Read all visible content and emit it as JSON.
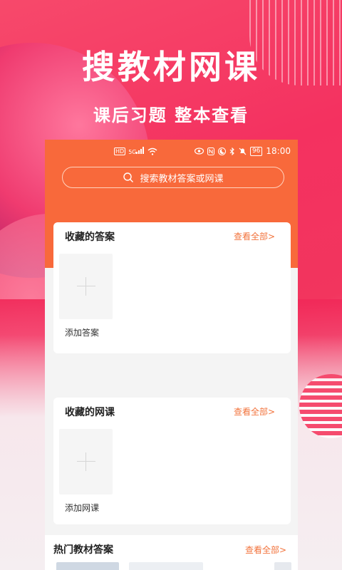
{
  "promo": {
    "headline": "搜教材网课",
    "subline": "课后习题 整本查看"
  },
  "statusbar": {
    "left_icons": [
      "hd-icon",
      "5g-signal-icon",
      "wifi-icon"
    ],
    "left_hd": "HD",
    "left_5g": "5G",
    "right_icons": [
      "eye-icon",
      "nfc-icon",
      "moon-icon",
      "bluetooth-icon",
      "mute-bell-icon"
    ],
    "battery": "96",
    "time": "18:00"
  },
  "search": {
    "placeholder": "搜索教材答案或网课"
  },
  "answers_card": {
    "title": "收藏的答案",
    "more": "查看全部>",
    "add_label": "添加答案"
  },
  "courses_card": {
    "title": "收藏的网课",
    "more": "查看全部>",
    "add_label": "添加网课"
  },
  "hot": {
    "title": "热门教材答案",
    "more": "查看全部>"
  },
  "colors": {
    "accent": "#f8693b",
    "link": "#f2733c",
    "background": "#f23a5c"
  }
}
